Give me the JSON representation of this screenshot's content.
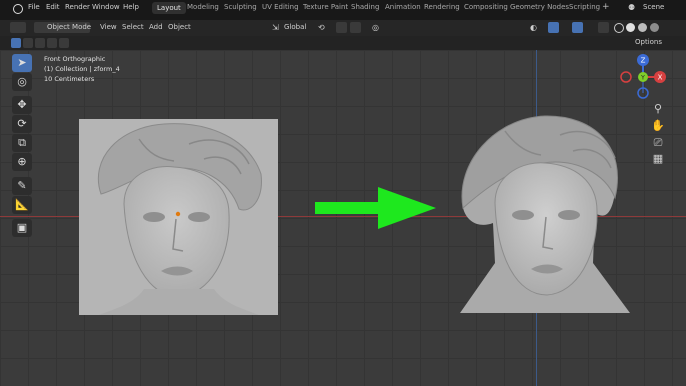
{
  "menu": [
    "File",
    "Edit",
    "Render",
    "Window",
    "Help"
  ],
  "workspaces": [
    "Layout",
    "Modeling",
    "Sculpting",
    "UV Editing",
    "Texture Paint",
    "Shading",
    "Animation",
    "Rendering",
    "Compositing",
    "Geometry Nodes",
    "Scripting"
  ],
  "scene_label": "Scene",
  "header": {
    "mode": "Object Mode",
    "view": "View",
    "select": "Select",
    "add": "Add",
    "object": "Object",
    "transform": "Global",
    "options": "Options"
  },
  "overlay": {
    "view_name": "Front Orthographic",
    "collection": "(1) Collection | zform_4",
    "scale": "10 Centimeters"
  },
  "gizmo": {
    "z": "Z",
    "y": "Y",
    "x": "X"
  },
  "colors": {
    "accent": "#4772b3",
    "arrow": "#1ee81e"
  }
}
